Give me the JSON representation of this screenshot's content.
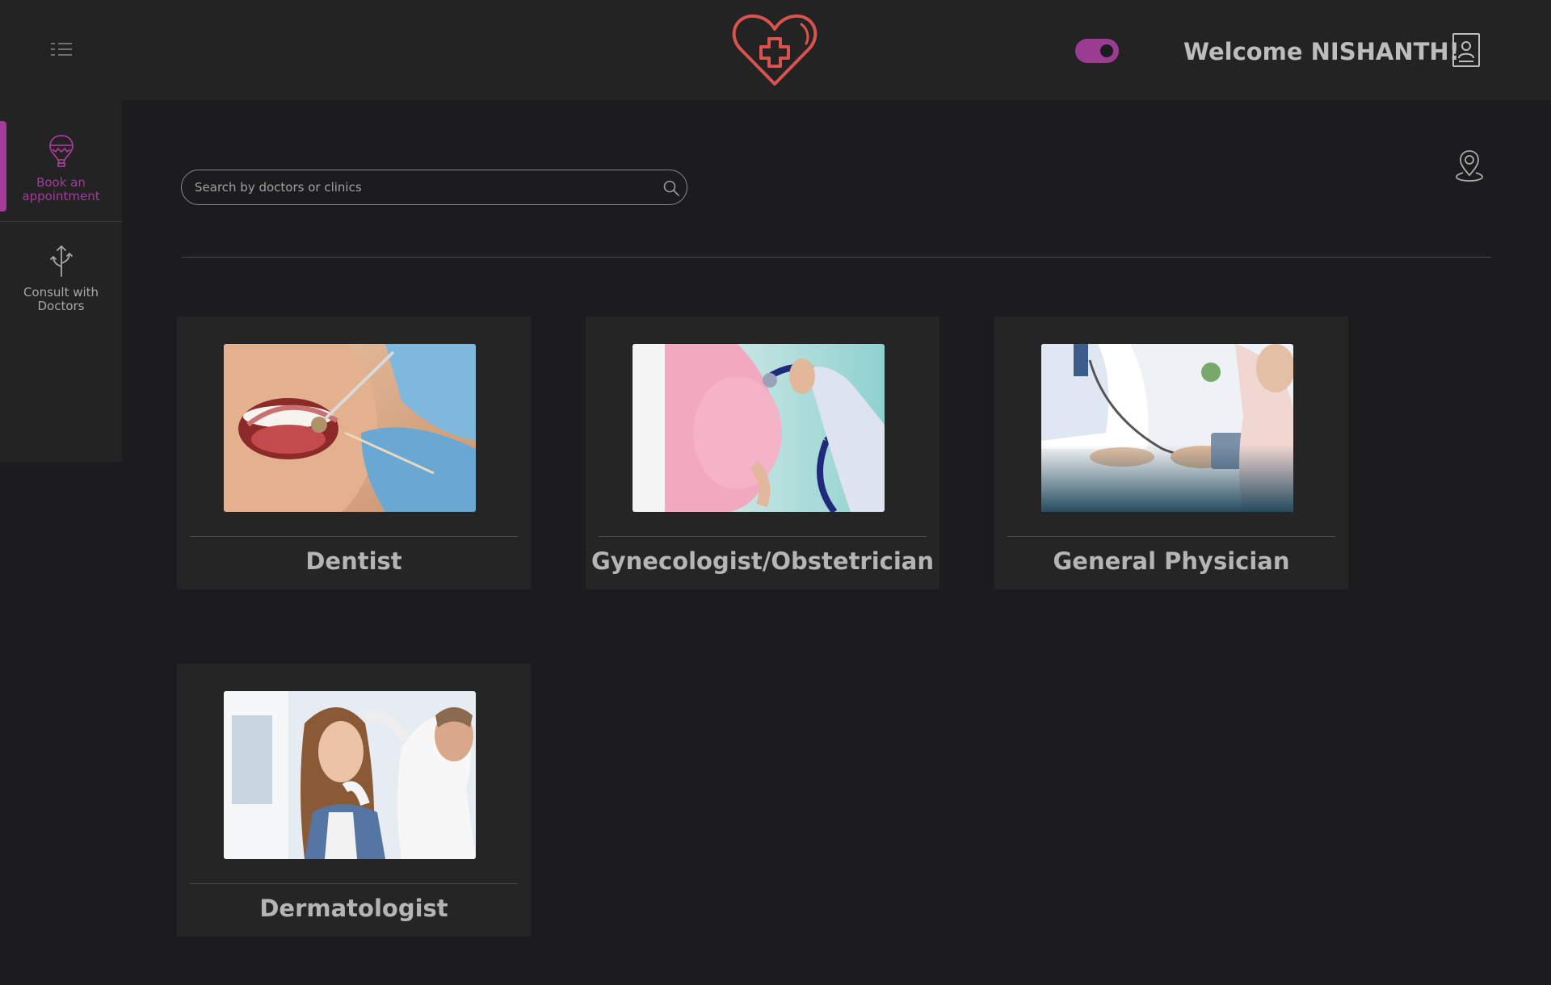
{
  "header": {
    "welcome_text": "Welcome NISHANTH!",
    "theme_toggle_on": true,
    "accent_color": "#a23c98",
    "logo_color": "#d9534f"
  },
  "sidebar": {
    "items": [
      {
        "label": "Book an appointment",
        "icon": "hot-air-balloon-icon",
        "active": true
      },
      {
        "label": "Consult with Doctors",
        "icon": "branch-arrow-icon",
        "active": false
      }
    ]
  },
  "search": {
    "placeholder": "Search by doctors or clinics",
    "value": ""
  },
  "specialties": [
    {
      "title": "Dentist",
      "image": "dentist-photo"
    },
    {
      "title": "Gynecologist/Obstetrician",
      "image": "pregnancy-checkup-photo"
    },
    {
      "title": "General Physician",
      "image": "blood-pressure-photo"
    },
    {
      "title": "Dermatologist",
      "image": "skin-examination-photo"
    }
  ]
}
